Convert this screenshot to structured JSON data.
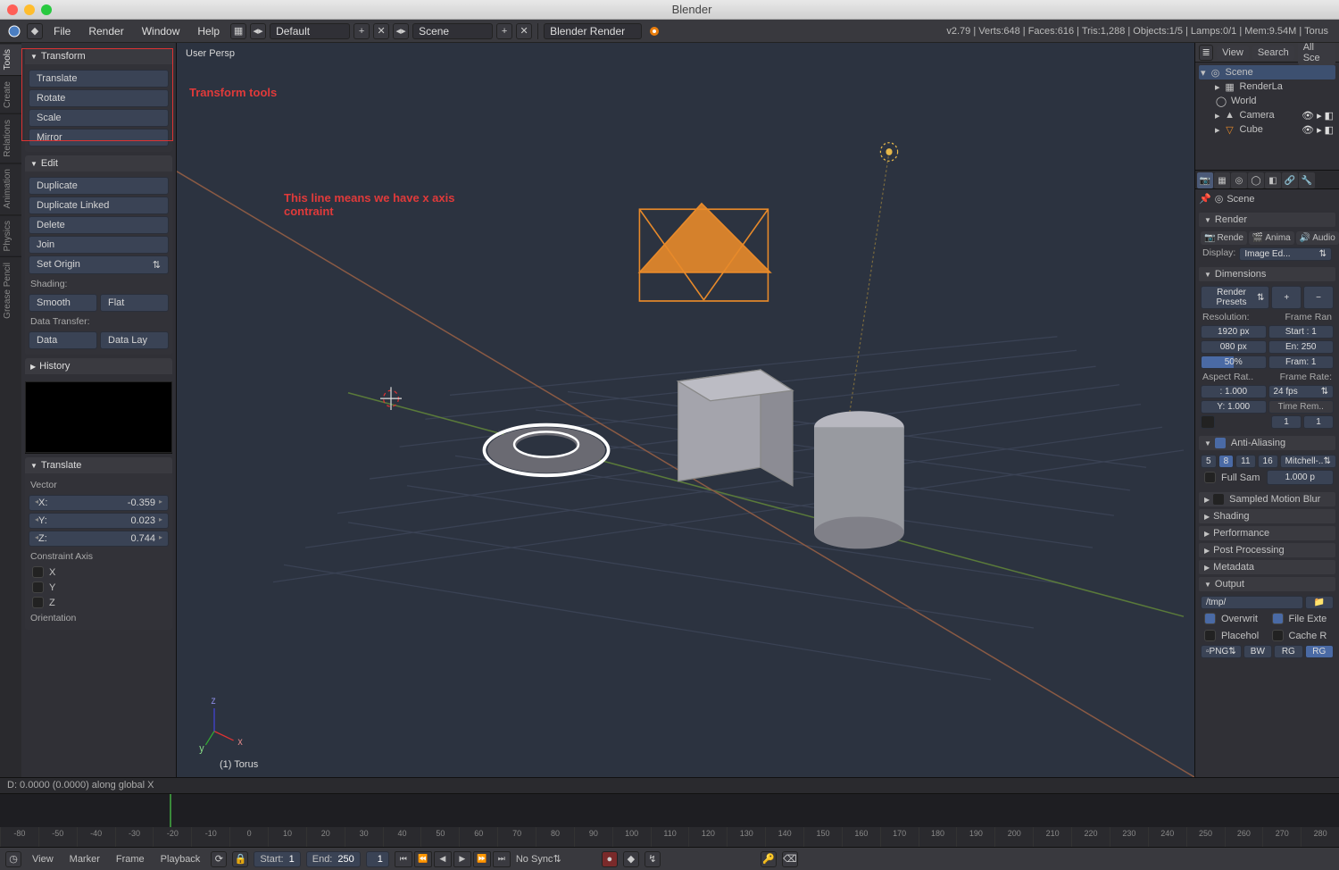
{
  "window": {
    "title": "Blender"
  },
  "menubar": {
    "items": [
      "File",
      "Render",
      "Window",
      "Help"
    ],
    "layout_dropdown": "Default",
    "scene_dropdown": "Scene",
    "engine_dropdown": "Blender Render",
    "stats": "v2.79 | Verts:648 | Faces:616 | Tris:1,288 | Objects:1/5 | Lamps:0/1 | Mem:9.54M | Torus"
  },
  "left": {
    "vtabs": [
      "Tools",
      "Create",
      "Relations",
      "Animation",
      "Physics",
      "Grease Pencil"
    ],
    "panels": {
      "transform": {
        "title": "Transform",
        "buttons": [
          "Translate",
          "Rotate",
          "Scale",
          "Mirror"
        ]
      },
      "edit": {
        "title": "Edit",
        "buttons": [
          "Duplicate",
          "Duplicate Linked",
          "Delete",
          "Join"
        ],
        "set_origin": "Set Origin",
        "shading_label": "Shading:",
        "shading": [
          "Smooth",
          "Flat"
        ],
        "datatransfer_label": "Data Transfer:",
        "datatransfer": [
          "Data",
          "Data Lay"
        ]
      },
      "history": {
        "title": "History"
      }
    }
  },
  "operator": {
    "title": "Translate",
    "vector_label": "Vector",
    "vector": {
      "X": "-0.359",
      "Y": "0.023",
      "Z": "0.744"
    },
    "constraint_label": "Constraint Axis",
    "constraint_axes": [
      "X",
      "Y",
      "Z"
    ],
    "orientation_label": "Orientation"
  },
  "viewport": {
    "header": "User Persp",
    "footer": "(1) Torus",
    "annot_tools": "Transform tools",
    "annot_axis": "This line means we have x axis contraint"
  },
  "status_translate": "D: 0.0000 (0.0000) along global X",
  "outliner": {
    "header": {
      "view": "View",
      "search": "Search",
      "filter": "All Sce"
    },
    "items": [
      {
        "name": "Scene",
        "indent": 0,
        "ico": "scene",
        "sel": true,
        "tools": false
      },
      {
        "name": "RenderLa",
        "indent": 1,
        "ico": "rl",
        "sel": false,
        "tools": false
      },
      {
        "name": "World",
        "indent": 1,
        "ico": "world",
        "sel": false,
        "tools": false
      },
      {
        "name": "Camera",
        "indent": 1,
        "ico": "cam",
        "sel": false,
        "tools": true
      },
      {
        "name": "Cube",
        "indent": 1,
        "ico": "mesh",
        "sel": false,
        "tools": true
      }
    ]
  },
  "properties": {
    "breadcrumb": "Scene",
    "render": {
      "title": "Render",
      "buttons": [
        "Rende",
        "Anima",
        "Audio"
      ],
      "display_label": "Display:",
      "display": "Image Ed..."
    },
    "dimensions": {
      "title": "Dimensions",
      "preset": "Render Presets",
      "resolution_label": "Resolution:",
      "frame_range_label": "Frame Ran",
      "res_x": "1920 px",
      "res_y": "080 px",
      "res_pct": "50%",
      "start": "Start : 1",
      "end": "En: 250",
      "step": "Fram: 1",
      "aspect_label": "Aspect Rat..",
      "framerate_label": "Frame Rate:",
      "aspect_x": ": 1.000",
      "aspect_y": "Y: 1.000",
      "fps": "24 fps",
      "timeremap": "Time Rem..",
      "tr_old": "1",
      "tr_new": "1"
    },
    "aa": {
      "title": "Anti-Aliasing",
      "samples": [
        "5",
        "8",
        "11",
        "16"
      ],
      "samples_sel": "8",
      "filter": "Mitchell-..",
      "fullsample": "Full Sam",
      "filtersize": "1.000 p"
    },
    "collapsed": [
      "Sampled Motion Blur",
      "Shading",
      "Performance",
      "Post Processing",
      "Metadata"
    ],
    "output": {
      "title": "Output",
      "path": "/tmp/",
      "overwrite": "Overwrit",
      "placeholder": "Placehol",
      "fileext": "File Exte",
      "cache": "Cache R",
      "format": "PNG",
      "channels": [
        "BW",
        "RG",
        "RG"
      ]
    }
  },
  "timeline": {
    "menus": [
      "View",
      "Marker",
      "Frame",
      "Playback"
    ],
    "start_label": "Start:",
    "start": "1",
    "end_label": "End:",
    "end": "250",
    "current": "1",
    "sync": "No Sync",
    "ticks": [
      "-80",
      "-50",
      "-40",
      "-30",
      "-20",
      "-10",
      "0",
      "10",
      "20",
      "30",
      "40",
      "50",
      "60",
      "70",
      "80",
      "90",
      "100",
      "110",
      "120",
      "130",
      "140",
      "150",
      "160",
      "170",
      "180",
      "190",
      "200",
      "210",
      "220",
      "230",
      "240",
      "250",
      "260",
      "270",
      "280"
    ]
  }
}
